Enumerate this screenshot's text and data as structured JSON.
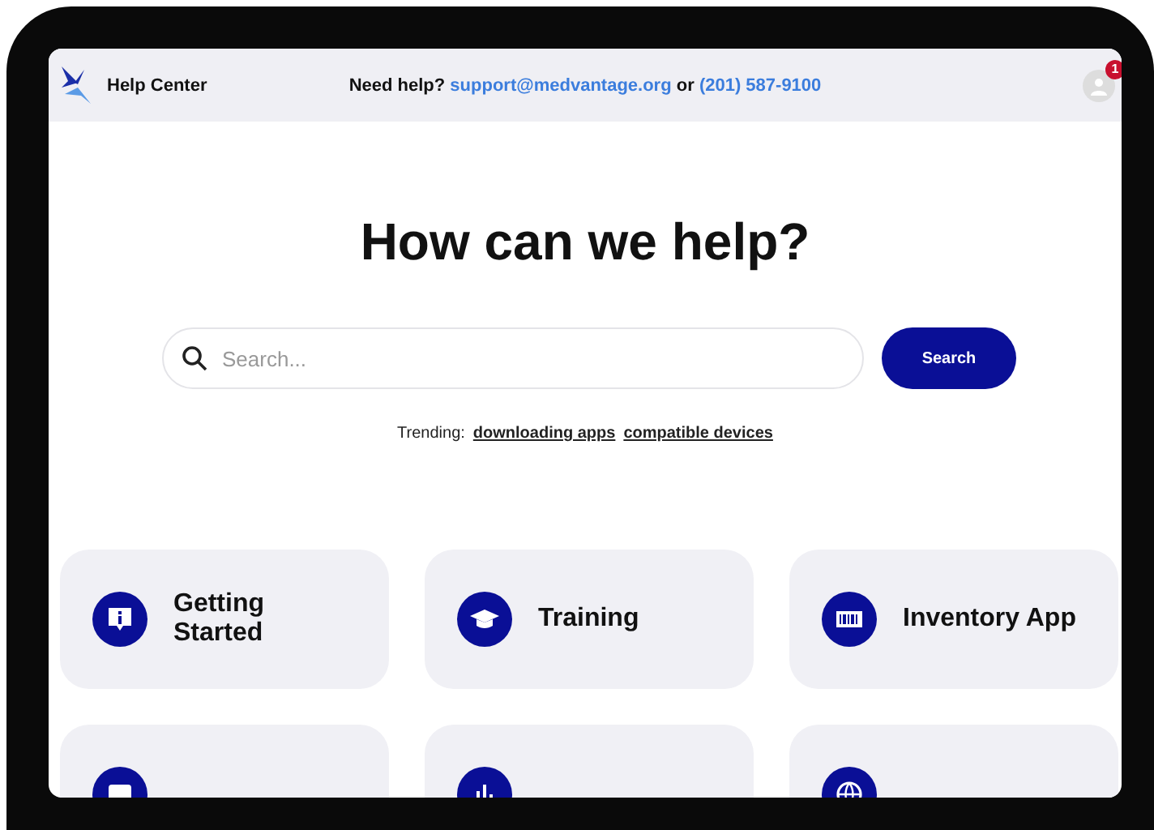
{
  "header": {
    "title": "Help Center",
    "help_prefix": "Need help?",
    "email": "support@medvantage.org",
    "joiner": "or",
    "phone": "(201) 587-9100",
    "notification_count": "1"
  },
  "hero": {
    "title": "How can we help?"
  },
  "search": {
    "placeholder": "Search...",
    "button": "Search"
  },
  "trending": {
    "label": "Trending:",
    "links": [
      "downloading apps",
      "compatible devices"
    ]
  },
  "categories": [
    {
      "kind": "info",
      "label": "Getting Started"
    },
    {
      "kind": "training",
      "label": "Training"
    },
    {
      "kind": "inventory",
      "label": "Inventory App"
    },
    {
      "kind": "chat"
    },
    {
      "kind": "chart"
    },
    {
      "kind": "globe"
    }
  ]
}
